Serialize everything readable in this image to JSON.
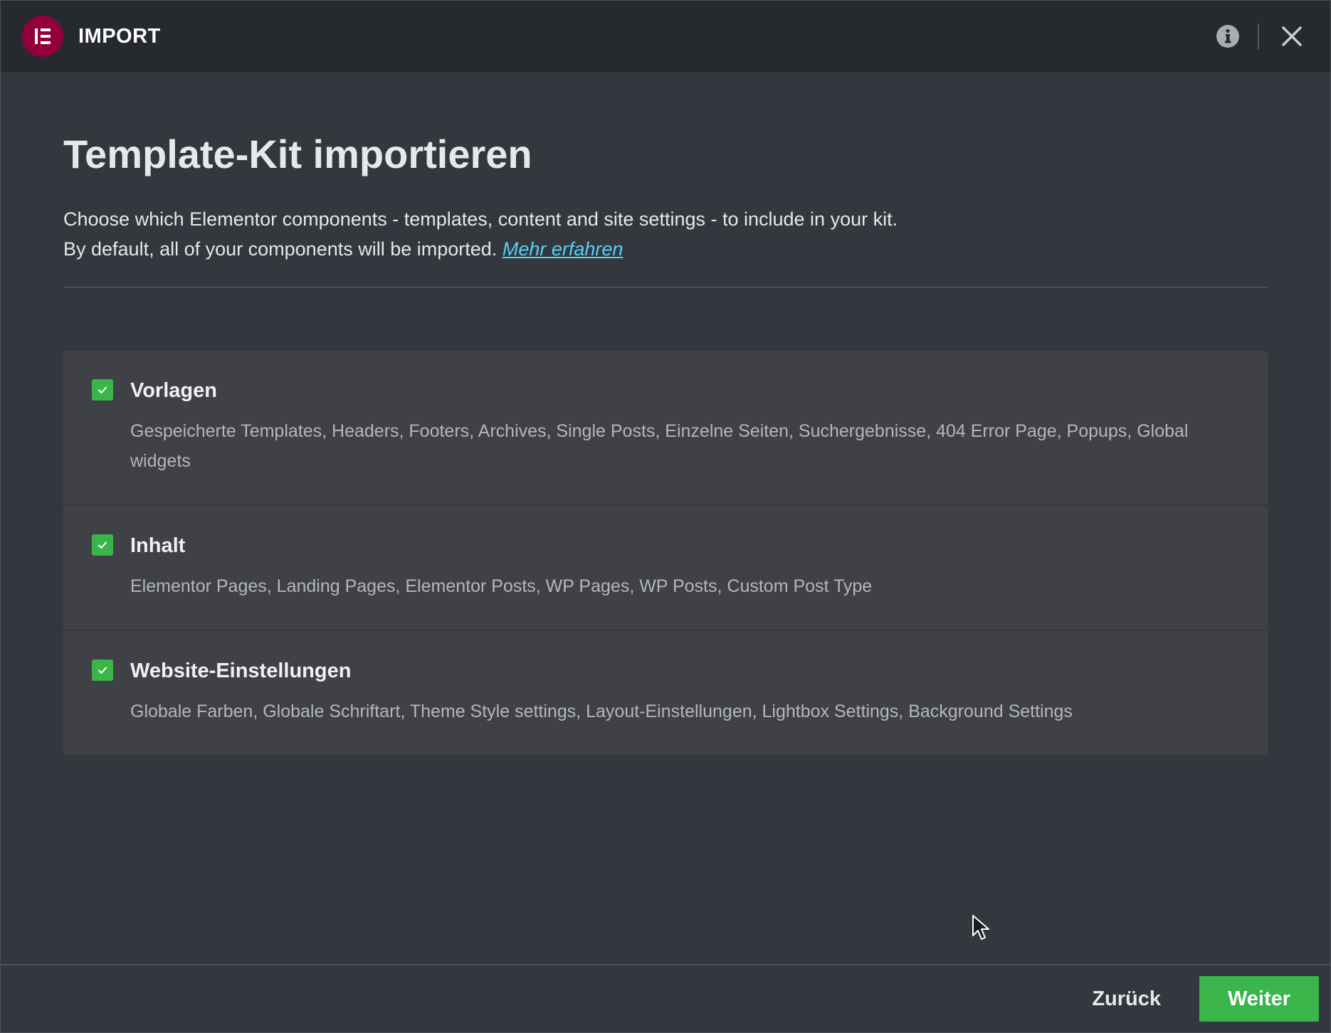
{
  "header": {
    "title": "IMPORT",
    "logo_icon": "elementor-logo-icon",
    "info_icon": "info-icon",
    "close_icon": "close-icon"
  },
  "main": {
    "title": "Template-Kit importieren",
    "intro_line1": "Choose which Elementor components - templates, content and site settings - to include in your kit.",
    "intro_line2": "By default, all of your components will be imported.",
    "learn_more_link": "Mehr erfahren"
  },
  "options": [
    {
      "title": "Vorlagen",
      "description": "Gespeicherte Templates, Headers, Footers, Archives, Single Posts, Einzelne Seiten, Suchergebnisse, 404 Error Page, Popups, Global widgets",
      "checked": true
    },
    {
      "title": "Inhalt",
      "description": "Elementor Pages, Landing Pages, Elementor Posts, WP Pages, WP Posts, Custom Post Type",
      "checked": true
    },
    {
      "title": "Website-Einstellungen",
      "description": "Globale Farben, Globale Schriftart, Theme Style settings, Layout-Einstellungen, Lightbox Settings, Background Settings",
      "checked": true
    }
  ],
  "footer": {
    "back_label": "Zurück",
    "next_label": "Weiter"
  },
  "colors": {
    "brand": "#92003b",
    "accent_green": "#39b54a",
    "link": "#58d0f5",
    "background": "#34373d",
    "header_background": "#26292d"
  }
}
